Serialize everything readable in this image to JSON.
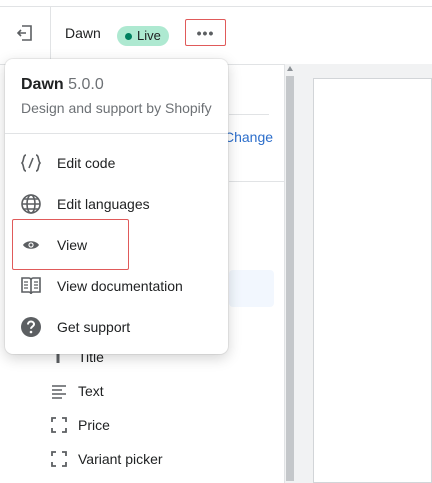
{
  "topbar": {
    "theme_name": "Dawn",
    "status_badge": "Live",
    "more_actions": "•••"
  },
  "background": {
    "change_link": "Change",
    "blocks": [
      {
        "label": "Title",
        "icon": "title-icon"
      },
      {
        "label": "Text",
        "icon": "text-icon"
      },
      {
        "label": "Price",
        "icon": "dashed-square-icon"
      },
      {
        "label": "Variant picker",
        "icon": "dashed-square-icon"
      }
    ]
  },
  "popover": {
    "title": "Dawn",
    "version": "5.0.0",
    "subtitle": "Design and support by Shopify",
    "items": [
      {
        "label": "Edit code",
        "icon": "code-icon"
      },
      {
        "label": "Edit languages",
        "icon": "globe-icon"
      },
      {
        "label": "View",
        "icon": "eye-icon"
      },
      {
        "label": "View documentation",
        "icon": "book-icon"
      },
      {
        "label": "Get support",
        "icon": "question-circle-icon"
      }
    ]
  },
  "colors": {
    "live_badge_bg": "#aee9d1",
    "live_dot": "#007f5f",
    "link": "#2c6ecb",
    "highlight_border": "#e05a5a"
  }
}
